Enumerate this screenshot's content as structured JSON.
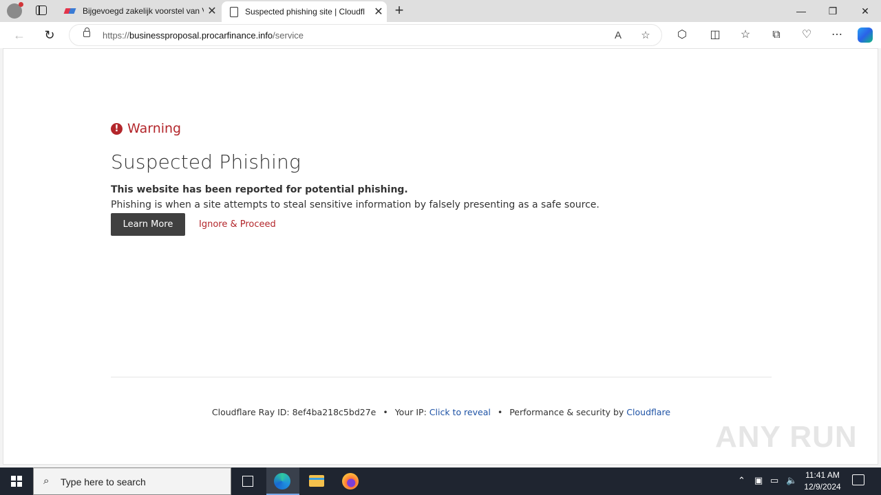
{
  "browser": {
    "tabs": [
      {
        "label": "Bijgevoegd zakelijk voorstel van V",
        "active": false
      },
      {
        "label": "Suspected phishing site | Cloudfl",
        "active": true
      }
    ],
    "new_tab": "+",
    "url_scheme": "https://",
    "url_host": "businessproposal.procarfinance.info",
    "url_path": "/service",
    "window_controls": [
      "—",
      "❐",
      "✕"
    ]
  },
  "page": {
    "warning_label": "Warning",
    "warning_symbol": "!",
    "heading": "Suspected Phishing",
    "bold_text": "This website has been reported for potential phishing.",
    "description": "Phishing is when a site attempts to steal sensitive information by falsely presenting as a safe source.",
    "learn_more": "Learn More",
    "ignore_proceed": "Ignore & Proceed",
    "accent_color": "#b3262b"
  },
  "footer": {
    "ray_label": "Cloudflare Ray ID:",
    "ray_id": "8ef4ba218c5bd27e",
    "ip_label": "Your IP:",
    "ip_link": "Click to reveal",
    "perf_label": "Performance & security by",
    "cloudflare_link": "Cloudflare",
    "bullet": "•"
  },
  "watermark": "ANY RUN",
  "taskbar": {
    "search_placeholder": "Type here to search",
    "time": "11:41 AM",
    "date": "12/9/2024"
  }
}
